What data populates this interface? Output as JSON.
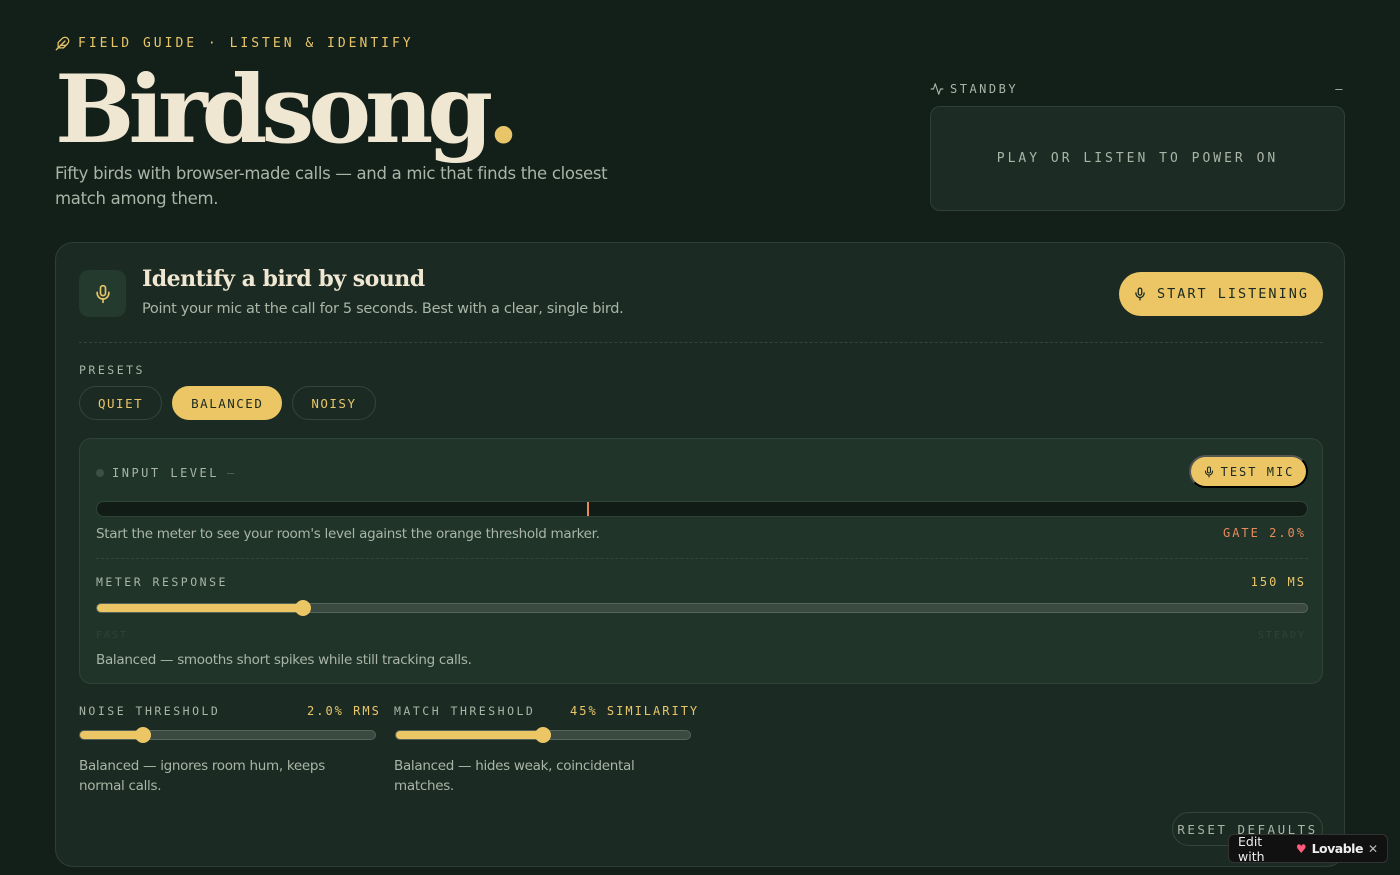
{
  "header": {
    "eyebrow": "Field Guide · Listen & Identify",
    "title": "Birdsong",
    "title_dot": ".",
    "subtitle": "Fifty birds with browser-made calls — and a mic that finds the closest match among them."
  },
  "status": {
    "label": "Standby",
    "indicator": "–",
    "display_text": "Play or listen to power on"
  },
  "identify": {
    "title": "Identify a bird by sound",
    "description": "Point your mic at the call for 5 seconds. Best with a clear, single bird.",
    "start_button": "Start listening"
  },
  "presets": {
    "label": "Presets",
    "items": [
      "Quiet",
      "Balanced",
      "Noisy"
    ],
    "active": "Balanced"
  },
  "input_level": {
    "label": "Input level",
    "indicator": "–",
    "test_button": "Test mic",
    "note": "Start the meter to see your room's level against the orange threshold marker.",
    "gate_label": "Gate 2.0%",
    "threshold_marker_fraction": 0.405
  },
  "meter_response": {
    "label": "Meter response",
    "value": "150 ms",
    "fraction": 0.17,
    "min_label": "Fast",
    "max_label": "Steady",
    "help": "Balanced — smooths short spikes while still tracking calls."
  },
  "noise_threshold": {
    "label": "Noise threshold",
    "value": "2.0% RMS",
    "fraction": 0.215,
    "help": "Balanced — ignores room hum, keeps normal calls."
  },
  "match_threshold": {
    "label": "Match threshold",
    "value": "45% similarity",
    "fraction": 0.5,
    "help": "Balanced — hides weak, coincidental matches."
  },
  "reset_button": "Reset defaults",
  "badge": {
    "prefix": "Edit with",
    "brand": "Lovable",
    "close": "✕"
  },
  "icons": {
    "eyebrow": "feather-icon",
    "status": "activity-icon",
    "mic": "microphone-icon"
  },
  "colors": {
    "background": "#13201a",
    "accent": "#ecc665",
    "threshold": "#e88b5a",
    "card": "#1b2b23"
  }
}
